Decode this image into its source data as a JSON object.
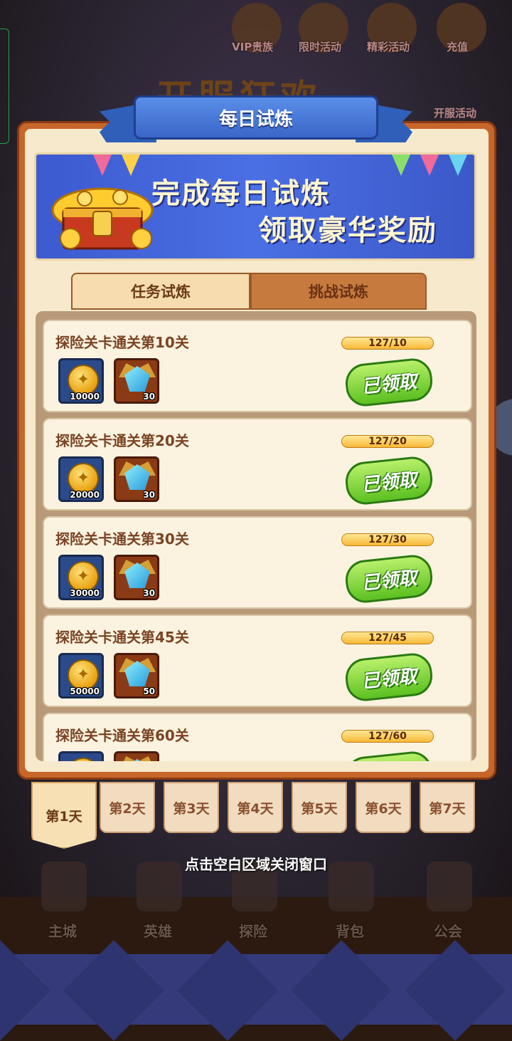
{
  "background": {
    "top_icons": [
      "VIP贵族",
      "限时活动",
      "精彩活动",
      "充值"
    ],
    "title_text": "开服狂欢",
    "open_activity_label": "开服活动",
    "bottom_nav": [
      "主城",
      "英雄",
      "探险",
      "背包",
      "公会"
    ]
  },
  "modal": {
    "title": "每日试炼",
    "banner": {
      "line1": "完成每日试炼",
      "line2": "领取豪华奖励"
    },
    "tabs": [
      {
        "label": "任务试炼",
        "active": true
      },
      {
        "label": "挑战试炼",
        "active": false
      }
    ],
    "tasks": [
      {
        "title": "探险关卡通关第10关",
        "progress_text": "127/10",
        "progress": 1.0,
        "rewards": [
          {
            "type": "coin-icon",
            "count": "10000"
          },
          {
            "type": "gem-icon",
            "count": "30"
          }
        ],
        "status": "已领取"
      },
      {
        "title": "探险关卡通关第20关",
        "progress_text": "127/20",
        "progress": 1.0,
        "rewards": [
          {
            "type": "coin-icon",
            "count": "20000"
          },
          {
            "type": "gem-icon",
            "count": "30"
          }
        ],
        "status": "已领取"
      },
      {
        "title": "探险关卡通关第30关",
        "progress_text": "127/30",
        "progress": 1.0,
        "rewards": [
          {
            "type": "coin-icon",
            "count": "30000"
          },
          {
            "type": "gem-icon",
            "count": "30"
          }
        ],
        "status": "已领取"
      },
      {
        "title": "探险关卡通关第45关",
        "progress_text": "127/45",
        "progress": 1.0,
        "rewards": [
          {
            "type": "coin-icon",
            "count": "50000"
          },
          {
            "type": "gem-icon",
            "count": "50"
          }
        ],
        "status": "已领取"
      },
      {
        "title": "探险关卡通关第60关",
        "progress_text": "127/60",
        "progress": 1.0,
        "rewards": [
          {
            "type": "coin-icon",
            "count": ""
          },
          {
            "type": "gem-icon",
            "count": ""
          }
        ],
        "status": ""
      }
    ],
    "days": [
      "第1天",
      "第2天",
      "第3天",
      "第4天",
      "第5天",
      "第6天",
      "第7天"
    ],
    "active_day_index": 0
  },
  "close_hint": "点击空白区域关闭窗口",
  "colors": {
    "modal_frame": "#c8662a",
    "panel": "#f6e9cc",
    "ribbon": "#3a66c8",
    "claimed_green": "#5cc020",
    "progress_orange": "#f0a020"
  }
}
